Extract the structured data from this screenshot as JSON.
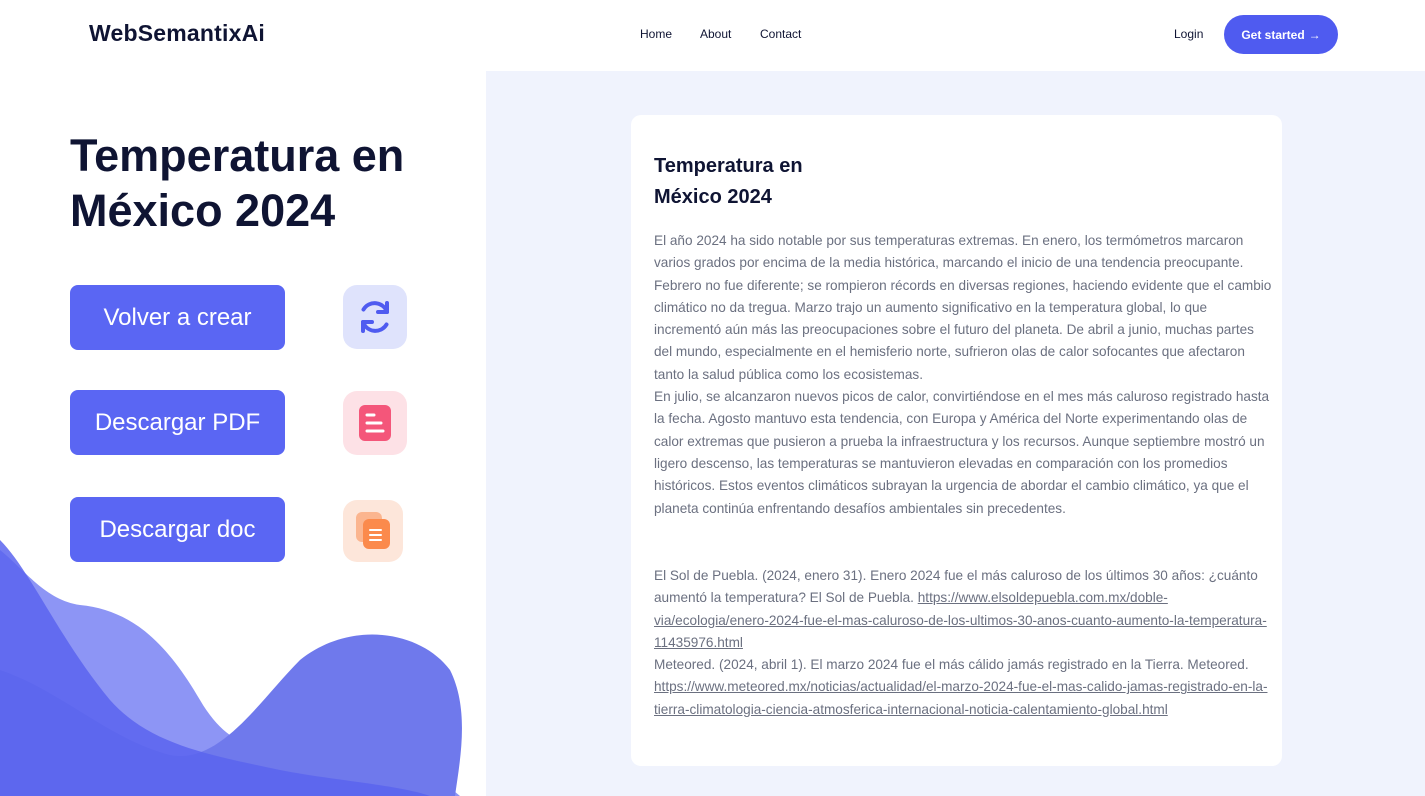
{
  "header": {
    "logo": "WebSemantixAi",
    "nav": [
      "Home",
      "About",
      "Contact"
    ],
    "login": "Login",
    "cta_label": "Get started",
    "cta_arrow": "→"
  },
  "hero": {
    "title": "Temperatura en México 2024"
  },
  "actions": {
    "recreate": "Volver a crear",
    "pdf": "Descargar PDF",
    "doc": "Descargar doc",
    "recreate_icon": "refresh-icon",
    "pdf_icon": "document-icon",
    "doc_icon": "copy-document-icon"
  },
  "article": {
    "title_line1": "Temperatura en",
    "title_line2": "México 2024",
    "paragraph1": "El año 2024 ha sido notable por sus temperaturas extremas. En enero, los termómetros marcaron varios grados por encima de la media histórica, marcando el inicio de una tendencia preocupante. Febrero no fue diferente; se rompieron récords en diversas regiones, haciendo evidente que el cambio climático no da tregua. Marzo trajo un aumento significativo en la temperatura global, lo que incrementó aún más las preocupaciones sobre el futuro del planeta. De abril a junio, muchas partes del mundo, especialmente en el hemisferio norte, sufrieron olas de calor sofocantes que afectaron tanto la salud pública como los ecosistemas.",
    "paragraph2": "En julio, se alcanzaron nuevos picos de calor, convirtiéndose en el mes más caluroso registrado hasta la fecha. Agosto mantuvo esta tendencia, con Europa y América del Norte experimentando olas de calor extremas que pusieron a prueba la infraestructura y los recursos. Aunque septiembre mostró un ligero descenso, las temperaturas se mantuvieron elevadas en comparación con los promedios históricos. Estos eventos climáticos subrayan la urgencia de abordar el cambio climático, ya que el planeta continúa enfrentando desafíos ambientales sin precedentes.",
    "ref1_text": "El Sol de Puebla. (2024, enero 31). Enero 2024 fue el más caluroso de los últimos 30 años: ¿cuánto aumentó la temperatura? El Sol de Puebla. ",
    "ref1_link": "https://www.elsoldepuebla.com.mx/doble-via/ecologia/enero-2024-fue-el-mas-caluroso-de-los-ultimos-30-anos-cuanto-aumento-la-temperatura-11435976.html",
    "ref2_text": "Meteored. (2024, abril 1). El marzo 2024 fue el más cálido jamás registrado en la Tierra. Meteored. ",
    "ref2_link": "https://www.meteored.mx/noticias/actualidad/el-marzo-2024-fue-el-mas-calido-jamas-registrado-en-la-tierra-climatologia-ciencia-atmosferica-internacional-noticia-calentamiento-global.html"
  },
  "colors": {
    "accent": "#4f5bf0",
    "panel_bg": "#f0f3fd",
    "text_dark": "#0f1433",
    "text_muted": "#6b7080"
  }
}
